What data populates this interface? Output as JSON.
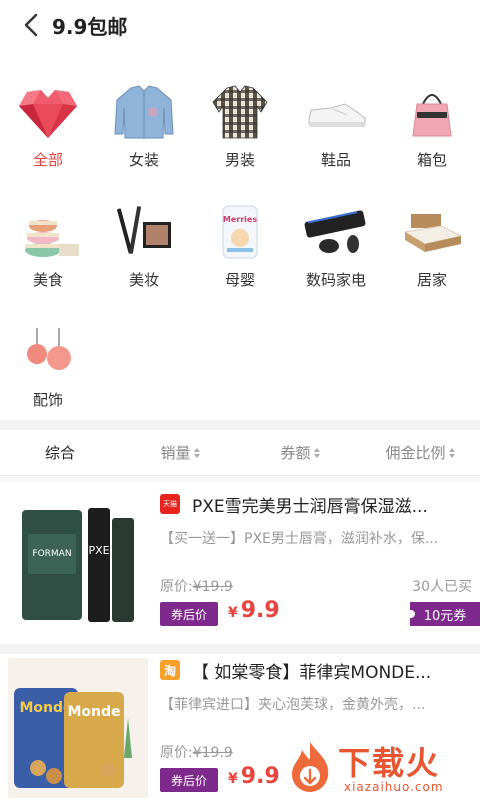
{
  "header": {
    "title": "9.9包邮"
  },
  "categories": [
    {
      "label": "全部",
      "icon": "heart-gem-icon",
      "active": true
    },
    {
      "label": "女装",
      "icon": "jacket-icon"
    },
    {
      "label": "男装",
      "icon": "shirt-icon"
    },
    {
      "label": "鞋品",
      "icon": "sneaker-icon"
    },
    {
      "label": "箱包",
      "icon": "handbag-icon"
    },
    {
      "label": "美食",
      "icon": "macaron-icon"
    },
    {
      "label": "美妆",
      "icon": "makeup-icon"
    },
    {
      "label": "母婴",
      "icon": "diaper-icon"
    },
    {
      "label": "数码家电",
      "icon": "keyboard-icon"
    },
    {
      "label": "居家",
      "icon": "bed-icon"
    },
    {
      "label": "配饰",
      "icon": "earring-icon"
    }
  ],
  "sort": [
    "综合",
    "销量",
    "券额",
    "佣金比例"
  ],
  "products": [
    {
      "shop_badge": "天猫",
      "shop_icon": "tmall-icon",
      "title": "PXE雪完美男士润唇膏保湿滋...",
      "desc": "【买一送一】PXE男士唇膏，滋润补水，保...",
      "orig_label": "原价:",
      "orig_price": "¥19.9",
      "sold": "30人已买",
      "after_label": "券后价",
      "currency": "¥",
      "price": "9.9",
      "coupon": "10元券"
    },
    {
      "shop_badge": "淘",
      "shop_icon": "taobao-icon",
      "title": "【 如棠零食】菲律宾MONDE...",
      "desc": "【菲律宾进口】夹心泡芙球，金黄外壳，...",
      "orig_label": "原价:",
      "orig_price": "¥19.9",
      "after_label": "券后价",
      "currency": "¥",
      "price": "9.9"
    }
  ],
  "watermark": {
    "text": "下载火",
    "url": "xiazaihuo.com"
  },
  "colors": {
    "accent": "#e8433d",
    "coupon": "#7e2a8c",
    "tmall": "#e8241f",
    "taobao": "#f5a02a"
  }
}
